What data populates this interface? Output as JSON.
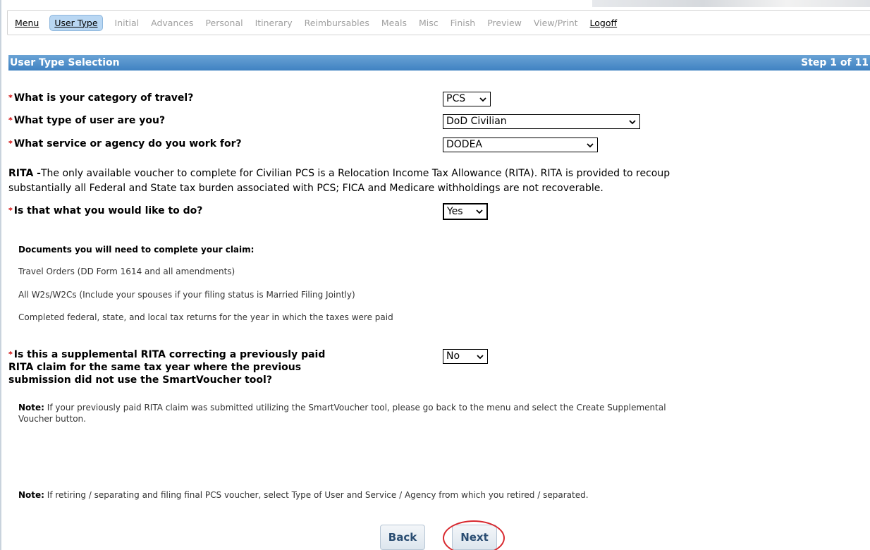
{
  "nav": {
    "items": [
      {
        "label": "Menu",
        "state": "link"
      },
      {
        "label": "User Type",
        "state": "active"
      },
      {
        "label": "Initial",
        "state": "disabled"
      },
      {
        "label": "Advances",
        "state": "disabled"
      },
      {
        "label": "Personal",
        "state": "disabled"
      },
      {
        "label": "Itinerary",
        "state": "disabled"
      },
      {
        "label": "Reimbursables",
        "state": "disabled"
      },
      {
        "label": "Meals",
        "state": "disabled"
      },
      {
        "label": "Misc",
        "state": "disabled"
      },
      {
        "label": "Finish",
        "state": "disabled"
      },
      {
        "label": "Preview",
        "state": "disabled"
      },
      {
        "label": "View/Print",
        "state": "disabled"
      },
      {
        "label": "Logoff",
        "state": "link"
      }
    ]
  },
  "section": {
    "title": "User Type Selection",
    "step": "Step 1 of 11"
  },
  "questions": {
    "category": {
      "label": "What is your category of travel?",
      "value": "PCS"
    },
    "user_type": {
      "label": "What type of user are you?",
      "value": "DoD Civilian"
    },
    "agency": {
      "label": "What service or agency do you work for?",
      "value": "DODEA"
    },
    "confirm": {
      "label": "Is that what you would like to do?",
      "value": "Yes"
    },
    "supplemental": {
      "label_line1": "Is this a supplemental RITA correcting a previously paid",
      "label_line2": "RITA claim for the same tax year where the previous",
      "label_line3": "submission did not use the SmartVoucher tool?",
      "value": "No"
    }
  },
  "rita": {
    "prefix": "RITA -",
    "text_line1": "The only available voucher to complete for Civilian PCS is a Relocation Income Tax Allowance (RITA). RITA is provided to recoup",
    "text_line2": "substantially all Federal and State tax burden associated with PCS; FICA and Medicare withholdings are not recoverable."
  },
  "documents": {
    "title": "Documents you will need to complete your claim:",
    "items": [
      "Travel Orders (DD Form 1614 and all amendments)",
      "All W2s/W2Cs (Include your spouses if your filing status is Married Filing Jointly)",
      "Completed federal, state, and local tax returns for the year in which the taxes were paid"
    ]
  },
  "notes": {
    "label": "Note:",
    "supplemental_line1": " If your previously paid RITA claim was submitted utilizing the SmartVoucher tool, please go back to the menu and select the Create Supplemental",
    "supplemental_line2": "Voucher button.",
    "retiring": " If retiring / separating and filing final PCS voucher, select Type of User and Service / Agency from which you retired / separated."
  },
  "buttons": {
    "back": "Back",
    "next": "Next"
  },
  "required_marker": "*",
  "colors": {
    "header_blue": "#4a8cc8",
    "active_tab": "#b9d7f3",
    "required_red": "#d00000",
    "highlight_ring": "#d8282e"
  }
}
